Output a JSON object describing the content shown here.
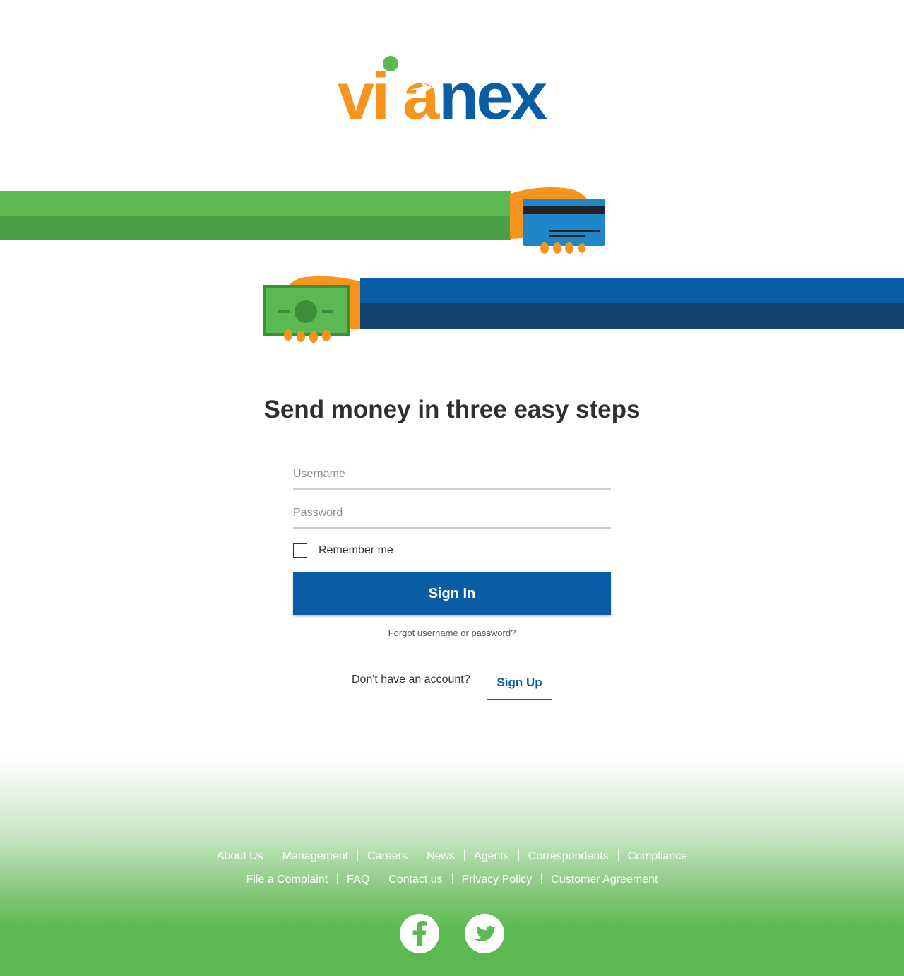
{
  "brand": {
    "name": "vianex",
    "colors": {
      "orange": "#f7941d",
      "blue": "#0a5ca5",
      "green": "#5cb850"
    }
  },
  "hero": {
    "headline": "Send money in three easy steps"
  },
  "login": {
    "username_placeholder": "Username",
    "password_placeholder": "Password",
    "remember_label": "Remember me",
    "remember_checked": false,
    "signin_label": "Sign In",
    "forgot_label": "Forgot username or password?",
    "no_account_text": "Don't have an account?",
    "signup_label": "Sign Up"
  },
  "footer": {
    "links_row1": [
      "About Us",
      "Management",
      "Careers",
      "News",
      "Agents",
      "Correspondents",
      "Compliance"
    ],
    "links_row2": [
      "File a Complaint",
      "FAQ",
      "Contact us",
      "Privacy Policy",
      "Customer Agreement"
    ],
    "social": [
      "facebook-icon",
      "twitter-icon"
    ]
  }
}
